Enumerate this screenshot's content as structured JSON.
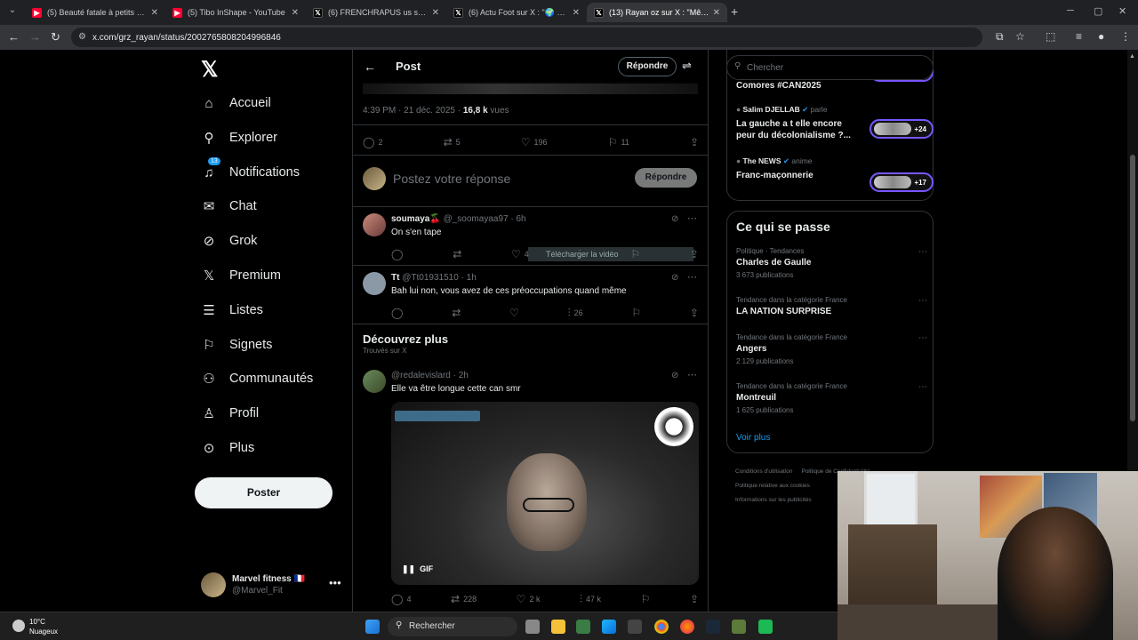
{
  "browser": {
    "tabs": [
      {
        "title": "(5) Beauté fatale à petits prix |",
        "favicon": "youtube-icon"
      },
      {
        "title": "(5) Tibo InShape - YouTube",
        "favicon": "youtube-icon"
      },
      {
        "title": "(6) FRENCHRAPUS us sur X : \"",
        "favicon": "x-icon"
      },
      {
        "title": "(6) Actu Foot sur X : \"🌍 LA PL",
        "favicon": "x-icon"
      },
      {
        "title": "(13) Rayan oz sur X : \"Même à",
        "favicon": "x-icon"
      }
    ],
    "url": "x.com/grz_rayan/status/2002765808204996846"
  },
  "nav": {
    "items": [
      {
        "label": "Accueil",
        "icon": "home-icon"
      },
      {
        "label": "Explorer",
        "icon": "search-icon"
      },
      {
        "label": "Notifications",
        "icon": "bell-icon",
        "badge": "13"
      },
      {
        "label": "Chat",
        "icon": "mail-icon"
      },
      {
        "label": "Grok",
        "icon": "grok-icon"
      },
      {
        "label": "Premium",
        "icon": "x-icon"
      },
      {
        "label": "Listes",
        "icon": "list-icon"
      },
      {
        "label": "Signets",
        "icon": "bookmark-icon"
      },
      {
        "label": "Communautés",
        "icon": "people-icon"
      },
      {
        "label": "Profil",
        "icon": "person-icon"
      },
      {
        "label": "Plus",
        "icon": "more-circle-icon"
      }
    ],
    "post_label": "Poster",
    "account": {
      "name": "Marvel fitness 🇫🇷",
      "handle": "@Marvel_Fit"
    }
  },
  "post": {
    "header_title": "Post",
    "reply_button": "Répondre",
    "time": "4:39 PM · 21 déc. 2025 · ",
    "views_value": "16,8 k",
    "views_label": " vues",
    "replies": "2",
    "reposts": "5",
    "likes": "196",
    "bookmarks": "11",
    "reply_placeholder": "Postez votre réponse",
    "reply_submit": "Répondre"
  },
  "replies": [
    {
      "name": "soumaya🍒",
      "handle": "@_soomayaa97 · 6h",
      "text": "On s'en tape",
      "views": "4"
    },
    {
      "name": "Tt",
      "handle": "@Tt01931510 · 1h",
      "text": "Bah lui non, vous avez de ces préoccupations quand même",
      "views": "26"
    }
  ],
  "overlay_text": "Télécharger la vidéo",
  "discover": {
    "title": "Découvrez plus",
    "subtitle": "Trouvés sur X",
    "tweet": {
      "handle": "@redalevislard · 2h",
      "text": "Elle va être longue cette can smr",
      "gif": "GIF",
      "replies": "4",
      "reposts": "228",
      "likes": "2 k",
      "views": "47 k"
    }
  },
  "search": {
    "placeholder": "Chercher"
  },
  "spaces": [
    {
      "host": "",
      "role": "",
      "title": "Comores #CAN2025",
      "count": ""
    },
    {
      "host": "Salim DJELLAB",
      "role": "parle",
      "title": "La gauche a t elle encore peur du décolonialisme ?...",
      "count": "+24"
    },
    {
      "host": "The NEWS",
      "role": "anime",
      "title": "Franc-maçonnerie",
      "count": "+17"
    }
  ],
  "trends": {
    "title": "Ce qui se passe",
    "items": [
      {
        "category": "Politique · Tendances",
        "name": "Charles de Gaulle",
        "count": "3 673 publications"
      },
      {
        "category": "Tendance dans la catégorie France",
        "name": "LA NATION SURPRISE",
        "count": ""
      },
      {
        "category": "Tendance dans la catégorie France",
        "name": "Angers",
        "count": "2 129 publications"
      },
      {
        "category": "Tendance dans la catégorie France",
        "name": "Montreuil",
        "count": "1 625 publications"
      }
    ],
    "more": "Voir plus"
  },
  "footer": {
    "links": [
      "Conditions d'utilisation",
      "Politique de Confidentialité",
      "Politique relative aux cookies",
      "Informations sur les publicités"
    ]
  },
  "taskbar": {
    "weather_temp": "10°C",
    "weather_desc": "Nuageux",
    "search_placeholder": "Rechercher"
  },
  "colors": {
    "accent": "#1d9bf0",
    "background": "#000000",
    "spaces_border": "#7856ff"
  }
}
